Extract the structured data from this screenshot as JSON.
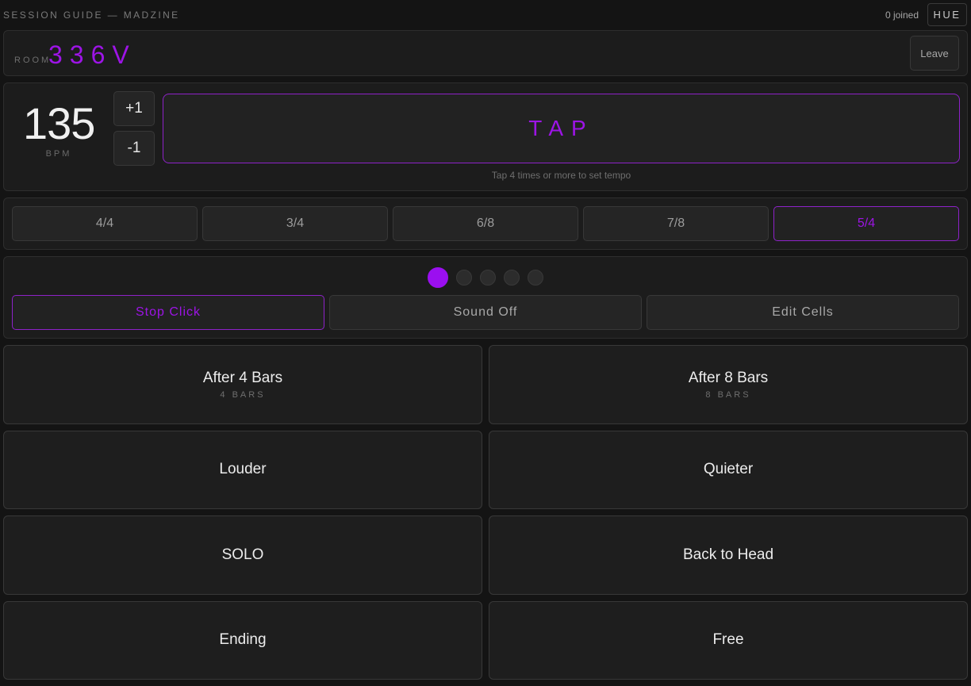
{
  "header": {
    "app_title": "SESSION GUIDE — MADZINE",
    "joined": "0 joined",
    "hue_label": "HUE"
  },
  "room": {
    "label": "ROOM",
    "code": "336V",
    "leave_label": "Leave"
  },
  "tempo": {
    "bpm": "135",
    "bpm_label": "BPM",
    "plus_label": "+1",
    "minus_label": "-1",
    "tap_label": "TAP",
    "tap_hint": "Tap 4 times or more to set tempo"
  },
  "time_signatures": {
    "options": [
      "4/4",
      "3/4",
      "6/8",
      "7/8",
      "5/4"
    ],
    "selected": "5/4"
  },
  "beat": {
    "count": 5,
    "current": 1
  },
  "controls": {
    "stop_click": "Stop Click",
    "sound_off": "Sound Off",
    "edit_cells": "Edit Cells"
  },
  "cues": [
    {
      "title": "After 4 Bars",
      "sub": "4 BARS"
    },
    {
      "title": "After 8 Bars",
      "sub": "8 BARS"
    },
    {
      "title": "Louder",
      "sub": ""
    },
    {
      "title": "Quieter",
      "sub": ""
    },
    {
      "title": "SOLO",
      "sub": ""
    },
    {
      "title": "Back to Head",
      "sub": ""
    },
    {
      "title": "Ending",
      "sub": ""
    },
    {
      "title": "Free",
      "sub": ""
    }
  ],
  "colors": {
    "accent": "#9d14e6",
    "background": "#141414",
    "panel": "#1c1c1c"
  }
}
